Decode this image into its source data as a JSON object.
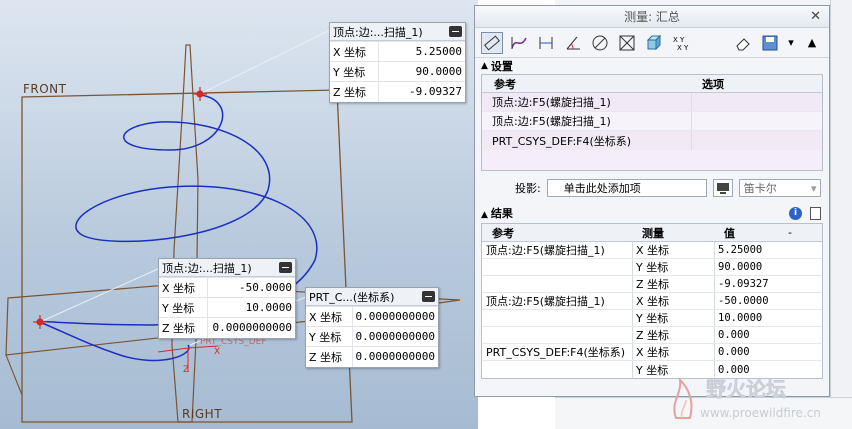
{
  "viewport": {
    "datum_front": "FRONT",
    "datum_right": "RIGHT",
    "csys_label": "PRT_CSYS_DEF"
  },
  "callout1": {
    "title": "顶点:边:...扫描_1)",
    "rows": [
      {
        "k": "X 坐标",
        "v": "5.25000"
      },
      {
        "k": "Y 坐标",
        "v": "90.0000"
      },
      {
        "k": "Z 坐标",
        "v": "-9.09327"
      }
    ]
  },
  "callout2": {
    "title": "顶点:边:...扫描_1)",
    "rows": [
      {
        "k": "X 坐标",
        "v": "-50.0000"
      },
      {
        "k": "Y 坐标",
        "v": "10.0000"
      },
      {
        "k": "Z 坐标",
        "v": "0.0000000000"
      }
    ]
  },
  "callout3": {
    "title": "PRT_C...(坐标系)",
    "rows": [
      {
        "k": "X 坐标",
        "v": "0.0000000000"
      },
      {
        "k": "Y 坐标",
        "v": "0.0000000000"
      },
      {
        "k": "Z 坐标",
        "v": "0.0000000000"
      }
    ]
  },
  "measure": {
    "title": "测量: 汇总",
    "settings_label": "设置",
    "col_ref": "参考",
    "col_options": "选项",
    "refs": [
      "顶点:边:F5(螺旋扫描_1)",
      "顶点:边:F5(螺旋扫描_1)",
      "PRT_CSYS_DEF:F4(坐标系)"
    ],
    "projection_label": "投影:",
    "projection_value": "单击此处添加项",
    "coord_system": "笛卡尔",
    "results_label": "结果",
    "res_col_ref": "参考",
    "res_col_measure": "测量",
    "res_col_value": "值",
    "res_col_extra": "-",
    "results": [
      {
        "ref": "顶点:边:F5(螺旋扫描_1)",
        "measure": "X 坐标",
        "value": "5.25000"
      },
      {
        "ref": "",
        "measure": "Y 坐标",
        "value": "90.0000"
      },
      {
        "ref": "",
        "measure": "Z 坐标",
        "value": "-9.09327"
      },
      {
        "ref": "顶点:边:F5(螺旋扫描_1)",
        "measure": "X 坐标",
        "value": "-50.0000"
      },
      {
        "ref": "",
        "measure": "Y 坐标",
        "value": "10.0000"
      },
      {
        "ref": "",
        "measure": "Z 坐标",
        "value": "0.000"
      },
      {
        "ref": "PRT_CSYS_DEF:F4(坐标系)",
        "measure": "X 坐标",
        "value": "0.000"
      },
      {
        "ref": "",
        "measure": "Y 坐标",
        "value": "0.000"
      }
    ]
  },
  "watermark": {
    "brand": "野火论坛",
    "url": "www.proewildfire.cn"
  },
  "colors": {
    "helix": "#1a2fbf",
    "datum": "#7a5535",
    "vertex": "#d42a2a"
  }
}
